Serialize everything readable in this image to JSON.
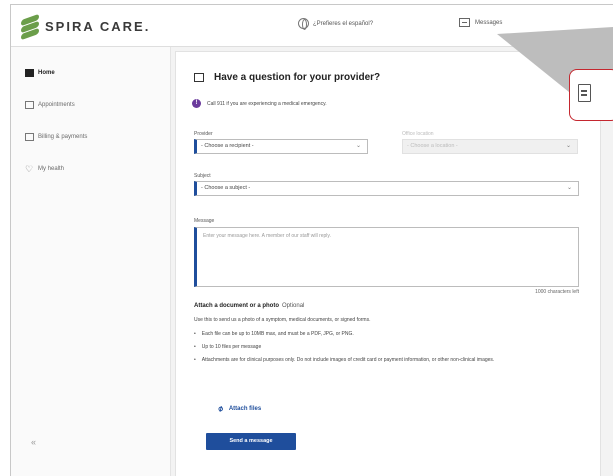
{
  "header": {
    "logo_text": "SPIRA CARE.",
    "language_link": "¿Prefieres el español?",
    "messages_link": "Messages"
  },
  "sidebar": {
    "items": [
      {
        "label": "Home",
        "icon": "home-icon",
        "active": true
      },
      {
        "label": "Appointments",
        "icon": "calendar-icon",
        "active": false
      },
      {
        "label": "Billing & payments",
        "icon": "billing-icon",
        "active": false
      },
      {
        "label": "My health",
        "icon": "heart-icon",
        "active": false
      }
    ],
    "collapse_glyph": "«"
  },
  "form": {
    "title": "Have a question for your provider?",
    "emergency_notice": "Call 911 if you are experiencing a medical emergency.",
    "provider_label": "Provider",
    "provider_value": "- Choose a recipient -",
    "office_label": "Office location",
    "office_value": "- Choose a location -",
    "subject_label": "Subject",
    "subject_value": "- Choose a subject -",
    "message_label": "Message",
    "message_placeholder": "Enter your message here. A member of our staff will reply.",
    "char_count": "1000 characters left",
    "attach_title": "Attach a document or a photo",
    "attach_optional": "Optional",
    "attach_desc": "Use this to send us a photo of a symptom, medical documents, or signed forms.",
    "bullets": [
      "Each file can be up to 10MB max, and must be a PDF, JPG, or PNG.",
      "Up to 10 files per message",
      "Attachments are for clinical purposes only. Do not include images of credit card or payment information, or other non-clinical images."
    ],
    "attach_files_label": "Attach files",
    "send_label": "Send a message"
  },
  "colors": {
    "brand_green": "#6b9e4a",
    "primary_blue": "#1f4e9c",
    "alert_purple": "#6a3a9c",
    "callout_red": "#c4272f"
  }
}
